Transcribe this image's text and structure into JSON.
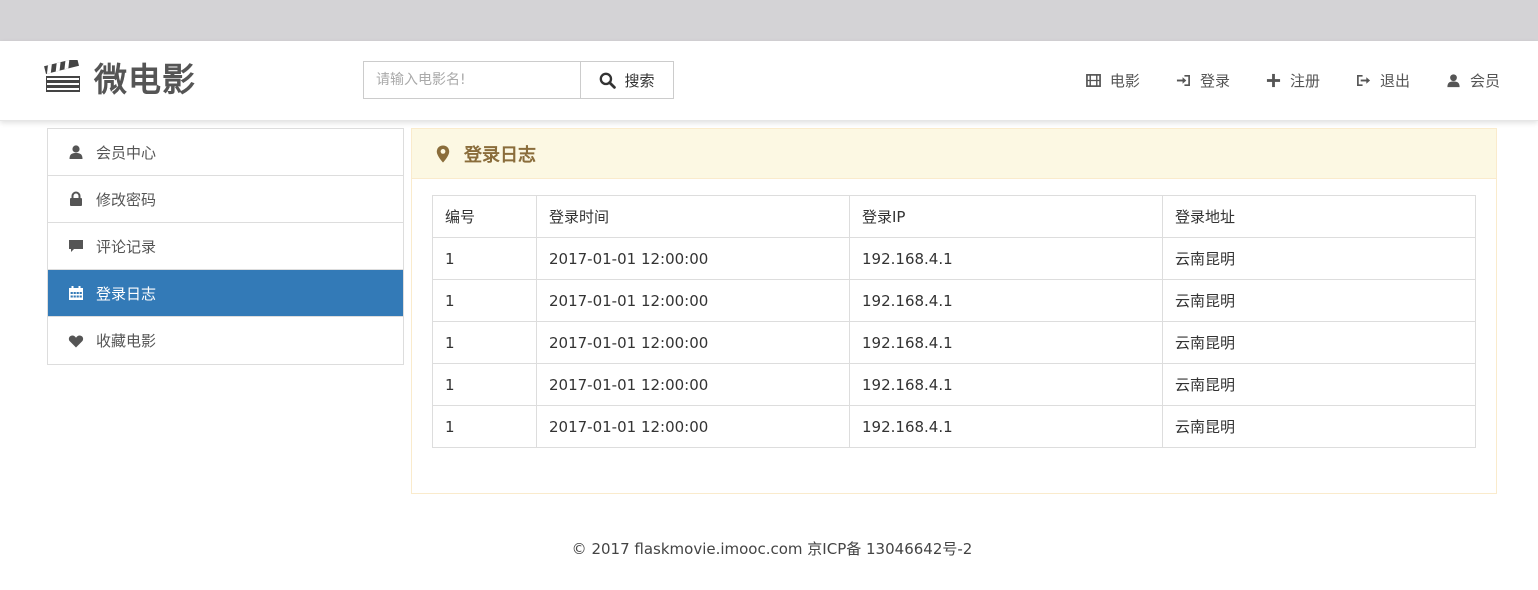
{
  "brand": {
    "name": "微电影"
  },
  "search": {
    "placeholder": "请输入电影名!",
    "button_label": "搜索"
  },
  "nav": [
    {
      "label": "电影",
      "icon": "film-icon"
    },
    {
      "label": "登录",
      "icon": "log-in-icon"
    },
    {
      "label": "注册",
      "icon": "plus-icon"
    },
    {
      "label": "退出",
      "icon": "log-out-icon"
    },
    {
      "label": "会员",
      "icon": "user-icon"
    }
  ],
  "sidebar": {
    "active_index": 3,
    "items": [
      {
        "label": "会员中心",
        "icon": "user-icon"
      },
      {
        "label": "修改密码",
        "icon": "lock-icon"
      },
      {
        "label": "评论记录",
        "icon": "comment-icon"
      },
      {
        "label": "登录日志",
        "icon": "calendar-icon"
      },
      {
        "label": "收藏电影",
        "icon": "heart-icon"
      }
    ]
  },
  "panel": {
    "title": "登录日志",
    "table": {
      "headers": [
        "编号",
        "登录时间",
        "登录IP",
        "登录地址"
      ],
      "rows": [
        [
          "1",
          "2017-01-01 12:00:00",
          "192.168.4.1",
          "云南昆明"
        ],
        [
          "1",
          "2017-01-01 12:00:00",
          "192.168.4.1",
          "云南昆明"
        ],
        [
          "1",
          "2017-01-01 12:00:00",
          "192.168.4.1",
          "云南昆明"
        ],
        [
          "1",
          "2017-01-01 12:00:00",
          "192.168.4.1",
          "云南昆明"
        ],
        [
          "1",
          "2017-01-01 12:00:00",
          "192.168.4.1",
          "云南昆明"
        ]
      ]
    }
  },
  "footer": {
    "text": "© 2017 flaskmovie.imooc.com 京ICP备 13046642号-2"
  },
  "colors": {
    "active_bg": "#337ab7",
    "panel_bg": "#fcf8e3",
    "panel_text": "#8a6d3b",
    "top_strip": "#d4d3d6"
  }
}
